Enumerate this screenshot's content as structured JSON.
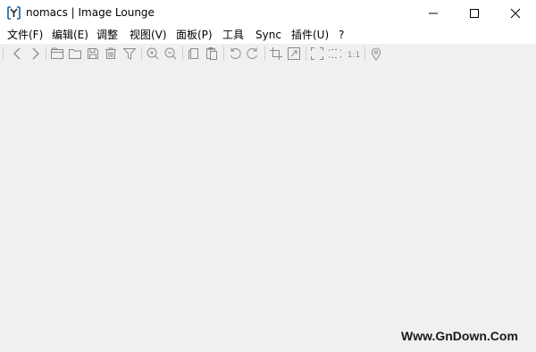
{
  "window": {
    "title": "nomacs | Image Lounge"
  },
  "menu": [
    "文件(F)",
    "编辑(E)",
    "调整",
    "视图(V)",
    "面板(P)",
    "工具",
    "Sync",
    "插件(U)",
    "?"
  ],
  "toolbar_icons": [
    "previous-icon",
    "next-icon",
    "open-folder-icon",
    "open-icon",
    "save-icon",
    "delete-icon",
    "filter-icon",
    "zoom-in-icon",
    "zoom-out-icon",
    "copy-icon",
    "paste-icon",
    "rotate-left-icon",
    "rotate-right-icon",
    "crop-icon",
    "resize-icon",
    "fullscreen-icon",
    "fit-icon",
    "actual-size-icon",
    "location-icon"
  ],
  "actual_size_label": "1:1",
  "watermark": "Www.GnDown.Com",
  "colors": {
    "icon": "#8a8a8a",
    "background": "#f0f0f0",
    "titlebar": "#ffffff"
  }
}
